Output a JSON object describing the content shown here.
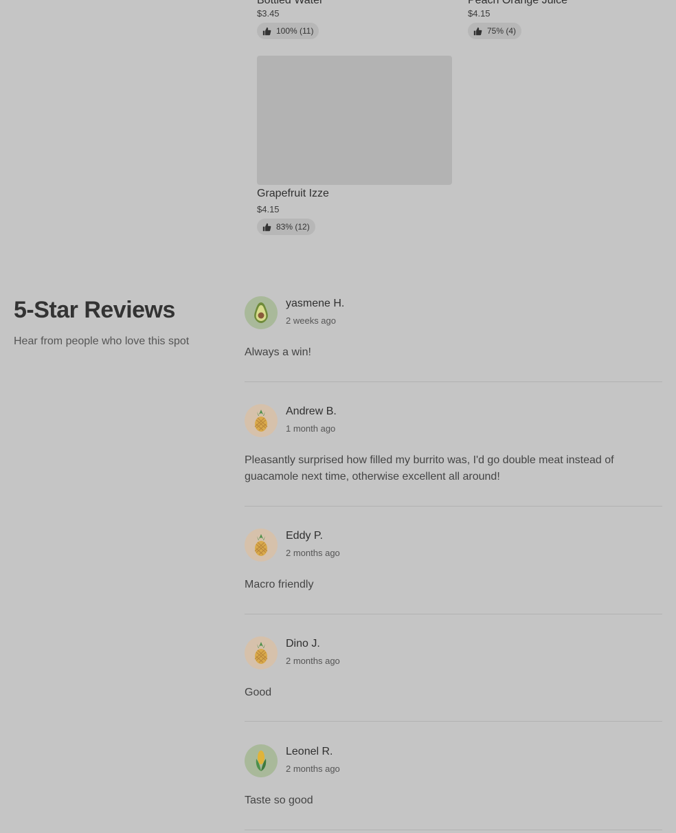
{
  "products": [
    {
      "name": "Bottled Water",
      "price": "$3.45",
      "rating": "100% (11)"
    },
    {
      "name": "Peach Orange Juice",
      "price": "$4.15",
      "rating": "75% (4)"
    },
    {
      "name": "Grapefruit Izze",
      "price": "$4.15",
      "rating": "83% (12)"
    }
  ],
  "reviews_section": {
    "title": "5-Star Reviews",
    "subtitle": "Hear from people who love this spot"
  },
  "reviews": [
    {
      "name": "yasmene H.",
      "date": "2 weeks ago",
      "text": "Always a win!",
      "avatar": "avocado-icon",
      "avatar_bg": "#a9b99a"
    },
    {
      "name": "Andrew B.",
      "date": "1 month ago",
      "text": "Pleasantly surprised how filled my burrito was, I'd go double meat instead of guacamole next time, otherwise excellent all around!",
      "avatar": "pineapple-icon",
      "avatar_bg": "#d6c1ab"
    },
    {
      "name": "Eddy P.",
      "date": "2 months ago",
      "text": "Macro friendly",
      "avatar": "pineapple-icon",
      "avatar_bg": "#d6c1ab"
    },
    {
      "name": "Dino J.",
      "date": "2 months ago",
      "text": "Good",
      "avatar": "pineapple-icon",
      "avatar_bg": "#d6c1ab"
    },
    {
      "name": "Leonel R.",
      "date": "2 months ago",
      "text": "Taste so good",
      "avatar": "corn-icon",
      "avatar_bg": "#a9b99a"
    }
  ]
}
